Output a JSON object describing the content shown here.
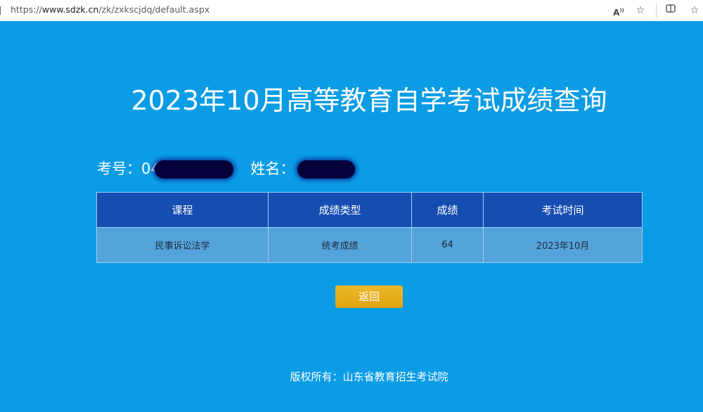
{
  "browser": {
    "url_prefix": "https://",
    "url_host": "www.sdzk.cn",
    "url_path": "/zk/zxkscjdq/default.aspx",
    "icons": [
      "read-aloud-icon",
      "favorite-star-icon",
      "split-screen-icon",
      "favorites-icon"
    ]
  },
  "page": {
    "title": "2023年10月高等教育自学考试成绩查询",
    "exam_no_label": "考号：04",
    "name_label": "姓名：",
    "table": {
      "headers": [
        "课程",
        "成绩类型",
        "成绩",
        "考试时间"
      ],
      "rows": [
        [
          "民事诉讼法学",
          "统考成绩",
          "64",
          "2023年10月"
        ]
      ]
    },
    "back_button": "返回",
    "footer": "版权所有：山东省教育招生考试院"
  },
  "colors": {
    "background": "#0a9ce5",
    "table_header": "#164db1",
    "table_row": "#55a3db",
    "button": "#e5a91c"
  }
}
